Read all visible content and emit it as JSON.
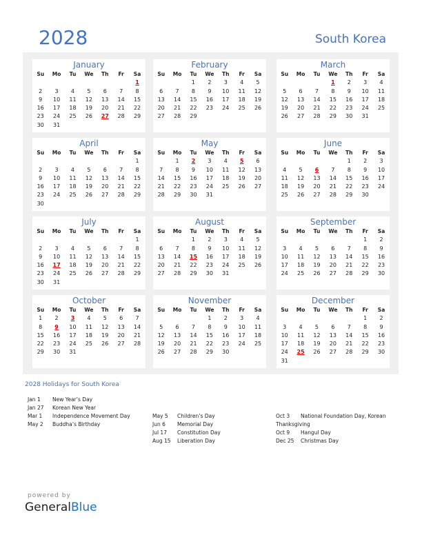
{
  "header": {
    "year": "2028",
    "country": "South Korea"
  },
  "weekday_labels": [
    "Su",
    "Mo",
    "Tu",
    "We",
    "Th",
    "Fr",
    "Sa"
  ],
  "months": [
    {
      "name": "January",
      "start": 6,
      "days": 31,
      "holidays": [
        1,
        27
      ]
    },
    {
      "name": "February",
      "start": 2,
      "days": 29,
      "holidays": []
    },
    {
      "name": "March",
      "start": 3,
      "days": 31,
      "holidays": [
        1
      ]
    },
    {
      "name": "April",
      "start": 6,
      "days": 30,
      "holidays": []
    },
    {
      "name": "May",
      "start": 1,
      "days": 31,
      "holidays": [
        2,
        5
      ]
    },
    {
      "name": "June",
      "start": 4,
      "days": 30,
      "holidays": [
        6
      ]
    },
    {
      "name": "July",
      "start": 6,
      "days": 31,
      "holidays": [
        17
      ]
    },
    {
      "name": "August",
      "start": 2,
      "days": 31,
      "holidays": [
        15
      ]
    },
    {
      "name": "September",
      "start": 5,
      "days": 30,
      "holidays": []
    },
    {
      "name": "October",
      "start": 0,
      "days": 31,
      "holidays": [
        3,
        9
      ]
    },
    {
      "name": "November",
      "start": 3,
      "days": 30,
      "holidays": []
    },
    {
      "name": "December",
      "start": 5,
      "days": 31,
      "holidays": [
        25
      ]
    }
  ],
  "holidays_title": "2028 Holidays for South Korea",
  "holiday_columns": [
    [
      {
        "date": "Jan 1",
        "name": "New Year’s Day"
      },
      {
        "date": "Jan 27",
        "name": "Korean New Year"
      },
      {
        "date": "Mar 1",
        "name": "Independence Movement Day"
      },
      {
        "date": "May 2",
        "name": "Buddha’s Birthday"
      }
    ],
    [
      {
        "date": "May 5",
        "name": "Children’s Day"
      },
      {
        "date": "Jun 6",
        "name": "Memorial Day"
      },
      {
        "date": "Jul 17",
        "name": "Constitution Day"
      },
      {
        "date": "Aug 15",
        "name": "Liberation Day"
      }
    ],
    [
      {
        "date": "Oct 3",
        "name": "National Foundation Day, Korean Thanksgiving"
      },
      {
        "date": "Oct 9",
        "name": "Hangul Day"
      },
      {
        "date": "Dec 25",
        "name": "Christmas Day"
      }
    ]
  ],
  "footer": {
    "powered_by": "powered by",
    "brand_general": "General",
    "brand_blue": "Blue"
  },
  "colors": {
    "accent": "#4472c4",
    "holiday": "#e00000",
    "panel": "#f0f0f0",
    "brand_blue": "#1a73c8"
  }
}
